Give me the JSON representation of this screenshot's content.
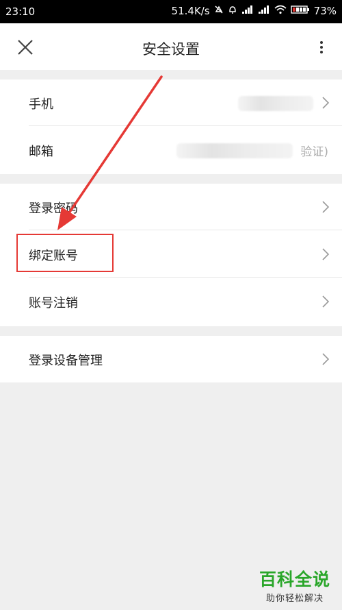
{
  "status_bar": {
    "time": "23:10",
    "network_speed": "51.4K/s",
    "battery": "73%",
    "icons": [
      "mute-icon",
      "alarm-icon",
      "signal-icon",
      "signal-icon",
      "wifi-icon",
      "battery-icon"
    ]
  },
  "header": {
    "title": "安全设置",
    "close_icon": "close-icon",
    "more_icon": "more-vertical-icon"
  },
  "sections": [
    {
      "items": [
        {
          "label": "手机",
          "value": "",
          "hint": "",
          "icon": "chevron-right-icon"
        },
        {
          "label": "邮箱",
          "value": "",
          "hint": "验证)",
          "icon": ""
        }
      ]
    },
    {
      "items": [
        {
          "label": "登录密码",
          "icon": "chevron-right-icon"
        },
        {
          "label": "绑定账号",
          "icon": "chevron-right-icon",
          "highlighted": true
        },
        {
          "label": "账号注销",
          "icon": "chevron-right-icon"
        }
      ]
    },
    {
      "items": [
        {
          "label": "登录设备管理",
          "icon": "chevron-right-icon"
        }
      ]
    }
  ],
  "annotation": {
    "color": "#e53935",
    "arrow_target": "绑定账号"
  },
  "watermark": {
    "line1": "百科全说",
    "line2": "助你轻松解决",
    "color": "#2aa62a"
  }
}
